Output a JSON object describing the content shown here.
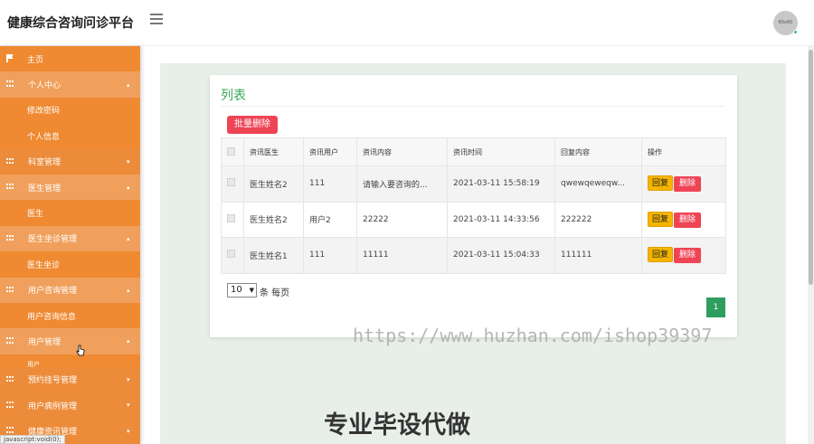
{
  "header": {
    "app_title": "健康综合咨询问诊平台",
    "avatar_text": "60x60"
  },
  "sidebar": {
    "items": [
      {
        "label": "主页",
        "kind": "top",
        "icon": "flag-icon"
      },
      {
        "label": "个人中心",
        "kind": "group",
        "open": true,
        "caret": "▴"
      },
      {
        "label": "修改密码",
        "kind": "sub"
      },
      {
        "label": "个人信息",
        "kind": "sub"
      },
      {
        "label": "科室管理",
        "kind": "group",
        "open": false,
        "caret": "▾"
      },
      {
        "label": "医生管理",
        "kind": "group",
        "open": true,
        "caret": "▴"
      },
      {
        "label": "医生",
        "kind": "sub"
      },
      {
        "label": "医生坐诊管理",
        "kind": "group",
        "open": true,
        "caret": "▴"
      },
      {
        "label": "医生坐诊",
        "kind": "sub"
      },
      {
        "label": "用户咨询管理",
        "kind": "group",
        "open": true,
        "caret": "▴"
      },
      {
        "label": "用户咨询信息",
        "kind": "sub"
      },
      {
        "label": "用户管理",
        "kind": "group",
        "open": true,
        "caret": "▴"
      },
      {
        "label": "用户",
        "kind": "sub"
      },
      {
        "label": "预约挂号管理",
        "kind": "group",
        "open": false,
        "caret": "▾"
      },
      {
        "label": "用户病例管理",
        "kind": "group",
        "open": false,
        "caret": "▾"
      },
      {
        "label": "健康资讯管理",
        "kind": "group",
        "open": false,
        "caret": "▾"
      }
    ]
  },
  "main": {
    "card_title": "列表",
    "batch_delete_label": "批量删除",
    "table": {
      "columns": [
        "资讯医生",
        "资讯用户",
        "资讯内容",
        "资讯时间",
        "回复内容",
        "操作"
      ],
      "rows": [
        {
          "doctor": "医生姓名2",
          "user": "111",
          "content": "请输入要咨询的...",
          "time": "2021-03-11 15:58:19",
          "reply": "qwewqeweqw..."
        },
        {
          "doctor": "医生姓名2",
          "user": "用户2",
          "content": "22222",
          "time": "2021-03-11 14:33:56",
          "reply": "222222"
        },
        {
          "doctor": "医生姓名1",
          "user": "111",
          "content": "11111",
          "time": "2021-03-11 15:04:33",
          "reply": "111111"
        }
      ],
      "reply_label": "回复",
      "delete_label": "删除"
    },
    "pager": {
      "page_size": "10",
      "per_page_text": "条 每页",
      "current_page": "1"
    }
  },
  "overlay": {
    "watermark": "https://www.huzhan.com/ishop39397",
    "promo": "专业毕设代做"
  },
  "statusbar": {
    "text": "javascript:void(0);"
  },
  "colors": {
    "sidebar": "#ef8a32",
    "accent_green": "#3aa85e",
    "danger": "#ee4455",
    "warning": "#f5b400",
    "pager_active": "#2e9e5e"
  }
}
